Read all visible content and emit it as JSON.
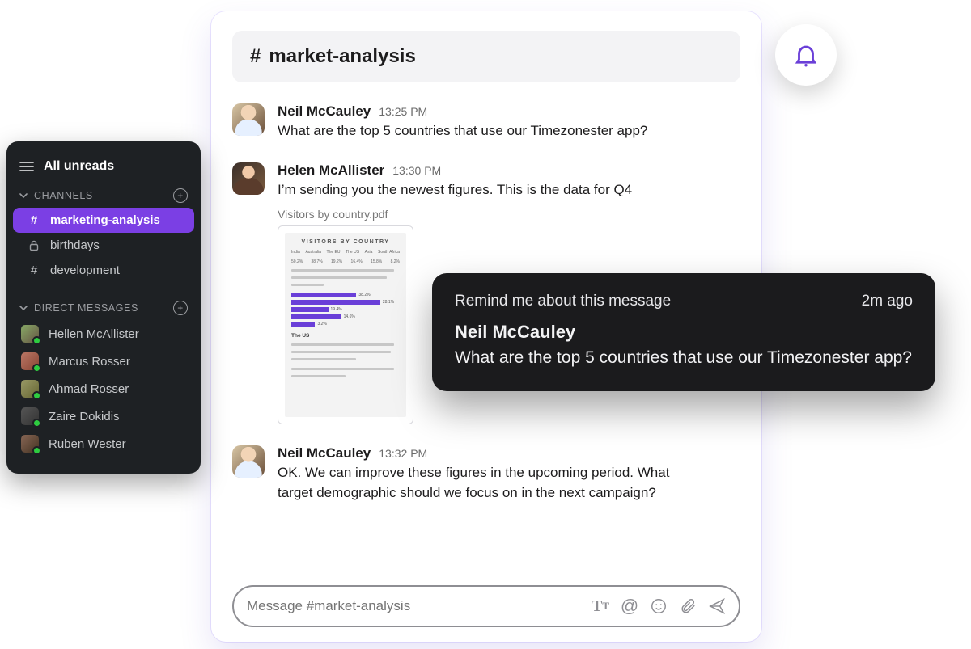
{
  "sidebar": {
    "all_unreads": "All unreads",
    "channels_label": "CHANNELS",
    "dm_label": "DIRECT MESSAGES",
    "channels": [
      {
        "name": "marketing-analysis",
        "icon": "hash",
        "active": true
      },
      {
        "name": "birthdays",
        "icon": "lock",
        "active": false
      },
      {
        "name": "development",
        "icon": "hash",
        "active": false
      }
    ],
    "dms": [
      {
        "name": "Hellen McAllister"
      },
      {
        "name": "Marcus Rosser"
      },
      {
        "name": "Ahmad Rosser"
      },
      {
        "name": "Zaire Dokidis"
      },
      {
        "name": "Ruben Wester"
      }
    ]
  },
  "channel_header": {
    "prefix": "#",
    "name": "market-analysis"
  },
  "messages": [
    {
      "author": "Neil McCauley",
      "avatar": "neil",
      "time": "13:25 PM",
      "text": "What are the top 5 countries that use our Timezonester app?"
    },
    {
      "author": "Helen McAllister",
      "avatar": "helen",
      "time": "13:30 PM",
      "text": " I’m sending you the newest figures. This is the data for Q4",
      "attachment": {
        "filename": "Visitors by country.pdf",
        "thumb_title": "VISITORS BY COUNTRY",
        "thumb_footer": "The US"
      }
    },
    {
      "author": "Neil McCauley",
      "avatar": "neil",
      "time": "13:32 PM",
      "text": "OK. We can improve these figures in the upcoming period. What target demographic should we focus on in the next campaign?"
    }
  ],
  "composer": {
    "placeholder": "Message #market-analysis"
  },
  "toast": {
    "title": "Remind me about this message",
    "age": "2m ago",
    "author": "Neil McCauley",
    "body": "What are the top 5 countries that use our Timezonester app?"
  }
}
